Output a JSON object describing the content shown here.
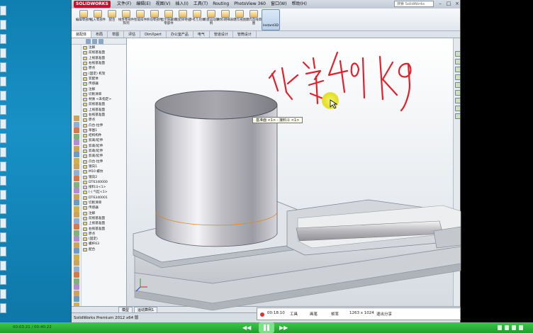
{
  "app": {
    "logo": "SOLIDWORKS",
    "window_icon": "solidworks-logo-icon"
  },
  "menu": [
    "文件(F)",
    "编辑(E)",
    "视图(V)",
    "插入(I)",
    "工具(T)",
    "Routing",
    "PhotoView 360",
    "窗口(W)",
    "帮助(H)"
  ],
  "search_placeholder": "搜索 SolidWorks",
  "ribbon": [
    {
      "label": "编辑零部件",
      "icon": "edit-component-icon"
    },
    {
      "label": "插入零部件",
      "icon": "insert-component-icon"
    },
    {
      "label": "配合",
      "icon": "mate-icon"
    },
    {
      "label": "线性零部件阵列",
      "icon": "pattern-icon"
    },
    {
      "label": "智能扣件",
      "icon": "smart-fastener-icon"
    },
    {
      "label": "移动零部件",
      "icon": "move-component-icon"
    },
    {
      "label": "显示隐藏的零部件",
      "icon": "show-hidden-icon"
    },
    {
      "label": "装配体特征",
      "icon": "assembly-feature-icon"
    },
    {
      "label": "参考几何体",
      "icon": "reference-geometry-icon"
    },
    {
      "label": "新建运动算例",
      "icon": "motion-study-icon"
    },
    {
      "label": "材料明细表",
      "icon": "bom-icon"
    },
    {
      "label": "爆炸视图",
      "icon": "explode-icon"
    },
    {
      "label": "爆炸直线草图",
      "icon": "explode-line-icon"
    }
  ],
  "instant3d": "Instant3D",
  "command_tabs": [
    "装配体",
    "布局",
    "草图",
    "评估",
    "DimXpert",
    "办公室产品",
    "电气",
    "管道设计",
    "管筒设计"
  ],
  "tree": [
    "注解",
    "前视基准面",
    "上视基准面",
    "右视基准面",
    "原点",
    "(固定) 机架",
    "装配体",
    "传感器",
    "注解",
    "切削清单",
    "材质 <未指定>",
    "前视基准面",
    "上视基准面",
    "右视基准面",
    "原点",
    "凸台-拉伸",
    "草图1",
    "结构构件",
    "剪裁/延伸",
    "剪裁/延伸",
    "剪裁/延伸",
    "剪裁/延伸",
    "凸台-拉伸",
    "镜向1",
    "M10 螺纹",
    "镜向2",
    "DT6340000",
    "接料斗<1>",
    "(-) 气缸<1>",
    "DT6340001",
    "切削清单",
    "传感器",
    "注解",
    "前视基准面",
    "上视基准面",
    "右视基准面",
    "原点",
    "(固定)",
    "螺杆63",
    "配合"
  ],
  "tooltip": "基准面 <1> - 接料斗 <1>",
  "bottom_tabs": [
    "模型",
    "运动算例1"
  ],
  "status": "SolidWorks Premium 2012 x64 版",
  "recorder": {
    "time": "00:18:10",
    "tools": "工具",
    "pen": "画笔",
    "mode": "帧率",
    "res": "1263 x 1024",
    "stop": "退出分享"
  },
  "player": {
    "time": "00:03:21 / 00:40:22"
  },
  "handwriting": "火焰 40KG"
}
